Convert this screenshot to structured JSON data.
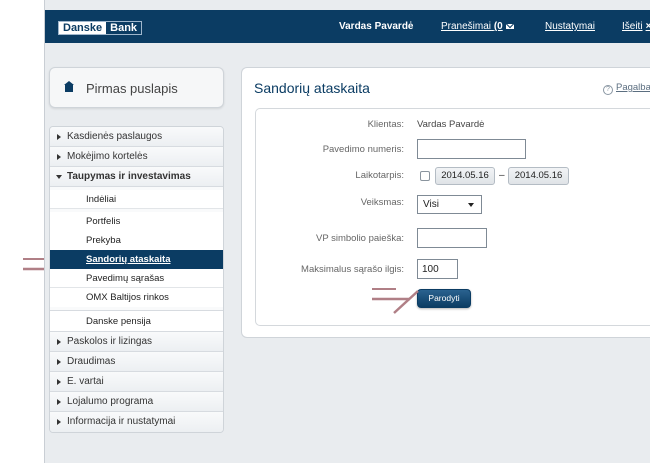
{
  "header": {
    "logo_word1": "Danske",
    "logo_word2": "Bank",
    "user_name": "Vardas Pavardė",
    "notifications_label": "Pranešimai",
    "notifications_count": "(0",
    "settings_label": "Nustatymai",
    "logout_label": "Išeiti",
    "logout_icon": "×",
    "color": "#0b3c63"
  },
  "sidebar": {
    "home_label": "Pirmas puslapis",
    "items": [
      {
        "label": "Kasdienės paslaugos"
      },
      {
        "label": "Mokėjimo kortelės"
      },
      {
        "label": "Taupymas ir investavimas",
        "open": true
      },
      {
        "label": "Paskolos ir lizingas"
      },
      {
        "label": "Draudimas"
      },
      {
        "label": "E. vartai"
      },
      {
        "label": "Lojalumo programa"
      },
      {
        "label": "Informacija ir nustatymai"
      }
    ],
    "subitems": [
      {
        "label": "Indėliai"
      },
      {
        "label": "Portfelis"
      },
      {
        "label": "Prekyba"
      },
      {
        "label": "Sandorių ataskaita",
        "active": true
      },
      {
        "label": "Pavedimų sąrašas"
      },
      {
        "label": "OMX Baltijos rinkos"
      },
      {
        "label": "Danske pensija"
      }
    ]
  },
  "main": {
    "title": "Sandorių ataskaita",
    "help_label": "Pagalba",
    "form": {
      "client_label": "Klientas:",
      "client_value": "Vardas Pavardė",
      "order_number_label": "Pavedimo numeris:",
      "order_number_value": "",
      "period_label": "Laikotarpis:",
      "period_checked": false,
      "date_from": "2014.05.16",
      "date_separator": "–",
      "date_to": "2014.05.16",
      "action_label": "Veiksmas:",
      "action_value": "Visi",
      "symbol_search_label": "VP simbolio paieška:",
      "symbol_search_value": "",
      "max_list_label": "Maksimalus sąrašo ilgis:",
      "max_list_value": "100",
      "submit_label": "Parodyti"
    }
  },
  "colors": {
    "brand": "#0b3c63",
    "arrow": "#b07f86"
  }
}
